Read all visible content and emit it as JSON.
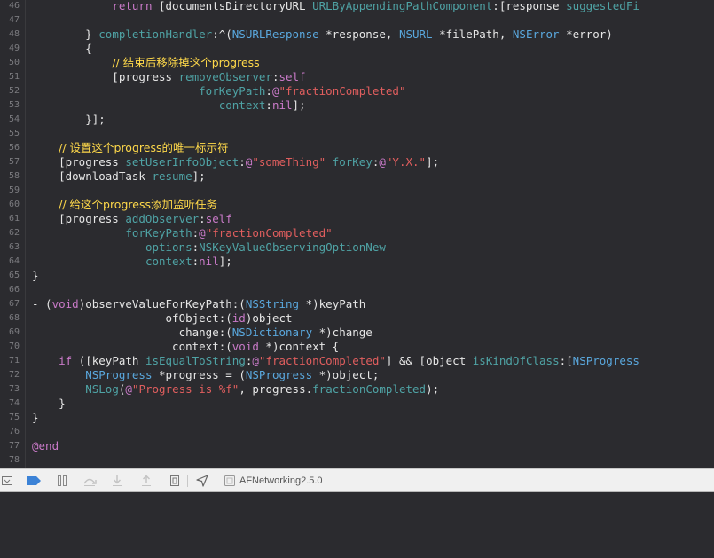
{
  "editor": {
    "lines": [
      {
        "num": "46",
        "tokens": [
          {
            "t": "            ",
            "c": "plain"
          },
          {
            "t": "return",
            "c": "kw"
          },
          {
            "t": " [documentsDirectoryURL ",
            "c": "plain"
          },
          {
            "t": "URLByAppendingPathComponent",
            "c": "mt"
          },
          {
            "t": ":[response ",
            "c": "plain"
          },
          {
            "t": "suggestedFi",
            "c": "mt"
          }
        ]
      },
      {
        "num": "47",
        "tokens": []
      },
      {
        "num": "48",
        "tokens": [
          {
            "t": "        } ",
            "c": "plain"
          },
          {
            "t": "completionHandler",
            "c": "mt"
          },
          {
            "t": ":^(",
            "c": "plain"
          },
          {
            "t": "NSURLResponse",
            "c": "ty"
          },
          {
            "t": " *response, ",
            "c": "plain"
          },
          {
            "t": "NSURL",
            "c": "ty"
          },
          {
            "t": " *filePath, ",
            "c": "plain"
          },
          {
            "t": "NSError",
            "c": "ty"
          },
          {
            "t": " *error)",
            "c": "plain"
          }
        ]
      },
      {
        "num": "49",
        "tokens": [
          {
            "t": "        {",
            "c": "plain"
          }
        ]
      },
      {
        "num": "50",
        "tokens": [
          {
            "t": "            ",
            "c": "plain"
          },
          {
            "t": "// 结束后移除掉这个progress",
            "c": "cm"
          }
        ]
      },
      {
        "num": "51",
        "tokens": [
          {
            "t": "            [progress ",
            "c": "plain"
          },
          {
            "t": "removeObserver",
            "c": "mt"
          },
          {
            "t": ":",
            "c": "plain"
          },
          {
            "t": "self",
            "c": "kw"
          }
        ]
      },
      {
        "num": "52",
        "tokens": [
          {
            "t": "                         ",
            "c": "plain"
          },
          {
            "t": "forKeyPath",
            "c": "mt"
          },
          {
            "t": ":",
            "c": "plain"
          },
          {
            "t": "@",
            "c": "at"
          },
          {
            "t": "\"fractionCompleted\"",
            "c": "st"
          }
        ]
      },
      {
        "num": "53",
        "tokens": [
          {
            "t": "                            ",
            "c": "plain"
          },
          {
            "t": "context",
            "c": "mt"
          },
          {
            "t": ":",
            "c": "plain"
          },
          {
            "t": "nil",
            "c": "kw"
          },
          {
            "t": "];",
            "c": "plain"
          }
        ]
      },
      {
        "num": "54",
        "tokens": [
          {
            "t": "        }];",
            "c": "plain"
          }
        ]
      },
      {
        "num": "55",
        "tokens": []
      },
      {
        "num": "56",
        "tokens": [
          {
            "t": "    ",
            "c": "plain"
          },
          {
            "t": "// 设置这个progress的唯一标示符",
            "c": "cm"
          }
        ]
      },
      {
        "num": "57",
        "tokens": [
          {
            "t": "    [progress ",
            "c": "plain"
          },
          {
            "t": "setUserInfoObject",
            "c": "mt"
          },
          {
            "t": ":",
            "c": "plain"
          },
          {
            "t": "@",
            "c": "at"
          },
          {
            "t": "\"someThing\"",
            "c": "st"
          },
          {
            "t": " ",
            "c": "plain"
          },
          {
            "t": "forKey",
            "c": "mt"
          },
          {
            "t": ":",
            "c": "plain"
          },
          {
            "t": "@",
            "c": "at"
          },
          {
            "t": "\"Y.X.\"",
            "c": "st"
          },
          {
            "t": "];",
            "c": "plain"
          }
        ]
      },
      {
        "num": "58",
        "tokens": [
          {
            "t": "    [downloadTask ",
            "c": "plain"
          },
          {
            "t": "resume",
            "c": "mt"
          },
          {
            "t": "];",
            "c": "plain"
          }
        ]
      },
      {
        "num": "59",
        "tokens": []
      },
      {
        "num": "60",
        "tokens": [
          {
            "t": "    ",
            "c": "plain"
          },
          {
            "t": "// 给这个progress添加监听任务",
            "c": "cm"
          }
        ]
      },
      {
        "num": "61",
        "tokens": [
          {
            "t": "    [progress ",
            "c": "plain"
          },
          {
            "t": "addObserver",
            "c": "mt"
          },
          {
            "t": ":",
            "c": "plain"
          },
          {
            "t": "self",
            "c": "kw"
          }
        ]
      },
      {
        "num": "62",
        "tokens": [
          {
            "t": "              ",
            "c": "plain"
          },
          {
            "t": "forKeyPath",
            "c": "mt"
          },
          {
            "t": ":",
            "c": "plain"
          },
          {
            "t": "@",
            "c": "at"
          },
          {
            "t": "\"fractionCompleted\"",
            "c": "st"
          }
        ]
      },
      {
        "num": "63",
        "tokens": [
          {
            "t": "                 ",
            "c": "plain"
          },
          {
            "t": "options",
            "c": "mt"
          },
          {
            "t": ":",
            "c": "plain"
          },
          {
            "t": "NSKeyValueObservingOptionNew",
            "c": "mt"
          }
        ]
      },
      {
        "num": "64",
        "tokens": [
          {
            "t": "                 ",
            "c": "plain"
          },
          {
            "t": "context",
            "c": "mt"
          },
          {
            "t": ":",
            "c": "plain"
          },
          {
            "t": "nil",
            "c": "kw"
          },
          {
            "t": "];",
            "c": "plain"
          }
        ]
      },
      {
        "num": "65",
        "tokens": [
          {
            "t": "}",
            "c": "plain"
          }
        ]
      },
      {
        "num": "66",
        "tokens": []
      },
      {
        "num": "67",
        "tokens": [
          {
            "t": "- (",
            "c": "plain"
          },
          {
            "t": "void",
            "c": "kw"
          },
          {
            "t": ")observeValueForKeyPath:(",
            "c": "plain"
          },
          {
            "t": "NSString",
            "c": "ty"
          },
          {
            "t": " *)keyPath",
            "c": "plain"
          }
        ]
      },
      {
        "num": "68",
        "tokens": [
          {
            "t": "                    ofObject:(",
            "c": "plain"
          },
          {
            "t": "id",
            "c": "kw"
          },
          {
            "t": ")object",
            "c": "plain"
          }
        ]
      },
      {
        "num": "69",
        "tokens": [
          {
            "t": "                      change:(",
            "c": "plain"
          },
          {
            "t": "NSDictionary",
            "c": "ty"
          },
          {
            "t": " *)change",
            "c": "plain"
          }
        ]
      },
      {
        "num": "70",
        "tokens": [
          {
            "t": "                     context:(",
            "c": "plain"
          },
          {
            "t": "void",
            "c": "kw"
          },
          {
            "t": " *)context {",
            "c": "plain"
          }
        ]
      },
      {
        "num": "71",
        "tokens": [
          {
            "t": "    ",
            "c": "plain"
          },
          {
            "t": "if",
            "c": "kw"
          },
          {
            "t": " ([keyPath ",
            "c": "plain"
          },
          {
            "t": "isEqualToString",
            "c": "mt"
          },
          {
            "t": ":",
            "c": "plain"
          },
          {
            "t": "@",
            "c": "at"
          },
          {
            "t": "\"fractionCompleted\"",
            "c": "st"
          },
          {
            "t": "] && [object ",
            "c": "plain"
          },
          {
            "t": "isKindOfClass",
            "c": "mt"
          },
          {
            "t": ":[",
            "c": "plain"
          },
          {
            "t": "NSProgress",
            "c": "ty"
          }
        ]
      },
      {
        "num": "72",
        "tokens": [
          {
            "t": "        ",
            "c": "plain"
          },
          {
            "t": "NSProgress",
            "c": "ty"
          },
          {
            "t": " *progress = (",
            "c": "plain"
          },
          {
            "t": "NSProgress",
            "c": "ty"
          },
          {
            "t": " *)object;",
            "c": "plain"
          }
        ]
      },
      {
        "num": "73",
        "tokens": [
          {
            "t": "        ",
            "c": "plain"
          },
          {
            "t": "NSLog",
            "c": "mt"
          },
          {
            "t": "(",
            "c": "plain"
          },
          {
            "t": "@",
            "c": "at"
          },
          {
            "t": "\"Progress is %f\"",
            "c": "st"
          },
          {
            "t": ", progress.",
            "c": "plain"
          },
          {
            "t": "fractionCompleted",
            "c": "mt"
          },
          {
            "t": ");",
            "c": "plain"
          }
        ]
      },
      {
        "num": "74",
        "tokens": [
          {
            "t": "    }",
            "c": "plain"
          }
        ]
      },
      {
        "num": "75",
        "tokens": [
          {
            "t": "}",
            "c": "plain"
          }
        ]
      },
      {
        "num": "76",
        "tokens": []
      },
      {
        "num": "77",
        "tokens": [
          {
            "t": "@end",
            "c": "kw"
          }
        ]
      },
      {
        "num": "78",
        "tokens": []
      }
    ]
  },
  "colors": {
    "editor_bg": "#2b2b2f",
    "plain": "#e6e6e6",
    "keyword": "#c97ac8",
    "type": "#5aa8de",
    "method": "#4fa3a5",
    "string": "#e05e5e",
    "comment": "#ffd94a",
    "toolbar_bg": "#f0f0f0",
    "breakpoint_blue": "#3b82d6"
  },
  "toolbar": {
    "scheme_label": "AFNetworking2.5.0",
    "icons": [
      "hide-debug-area-icon",
      "breakpoints-toggle-icon",
      "pause-continue-icon",
      "step-over-icon",
      "step-into-icon",
      "step-out-icon",
      "view-debugging-icon",
      "simulate-location-icon",
      "scheme-target-icon"
    ]
  }
}
